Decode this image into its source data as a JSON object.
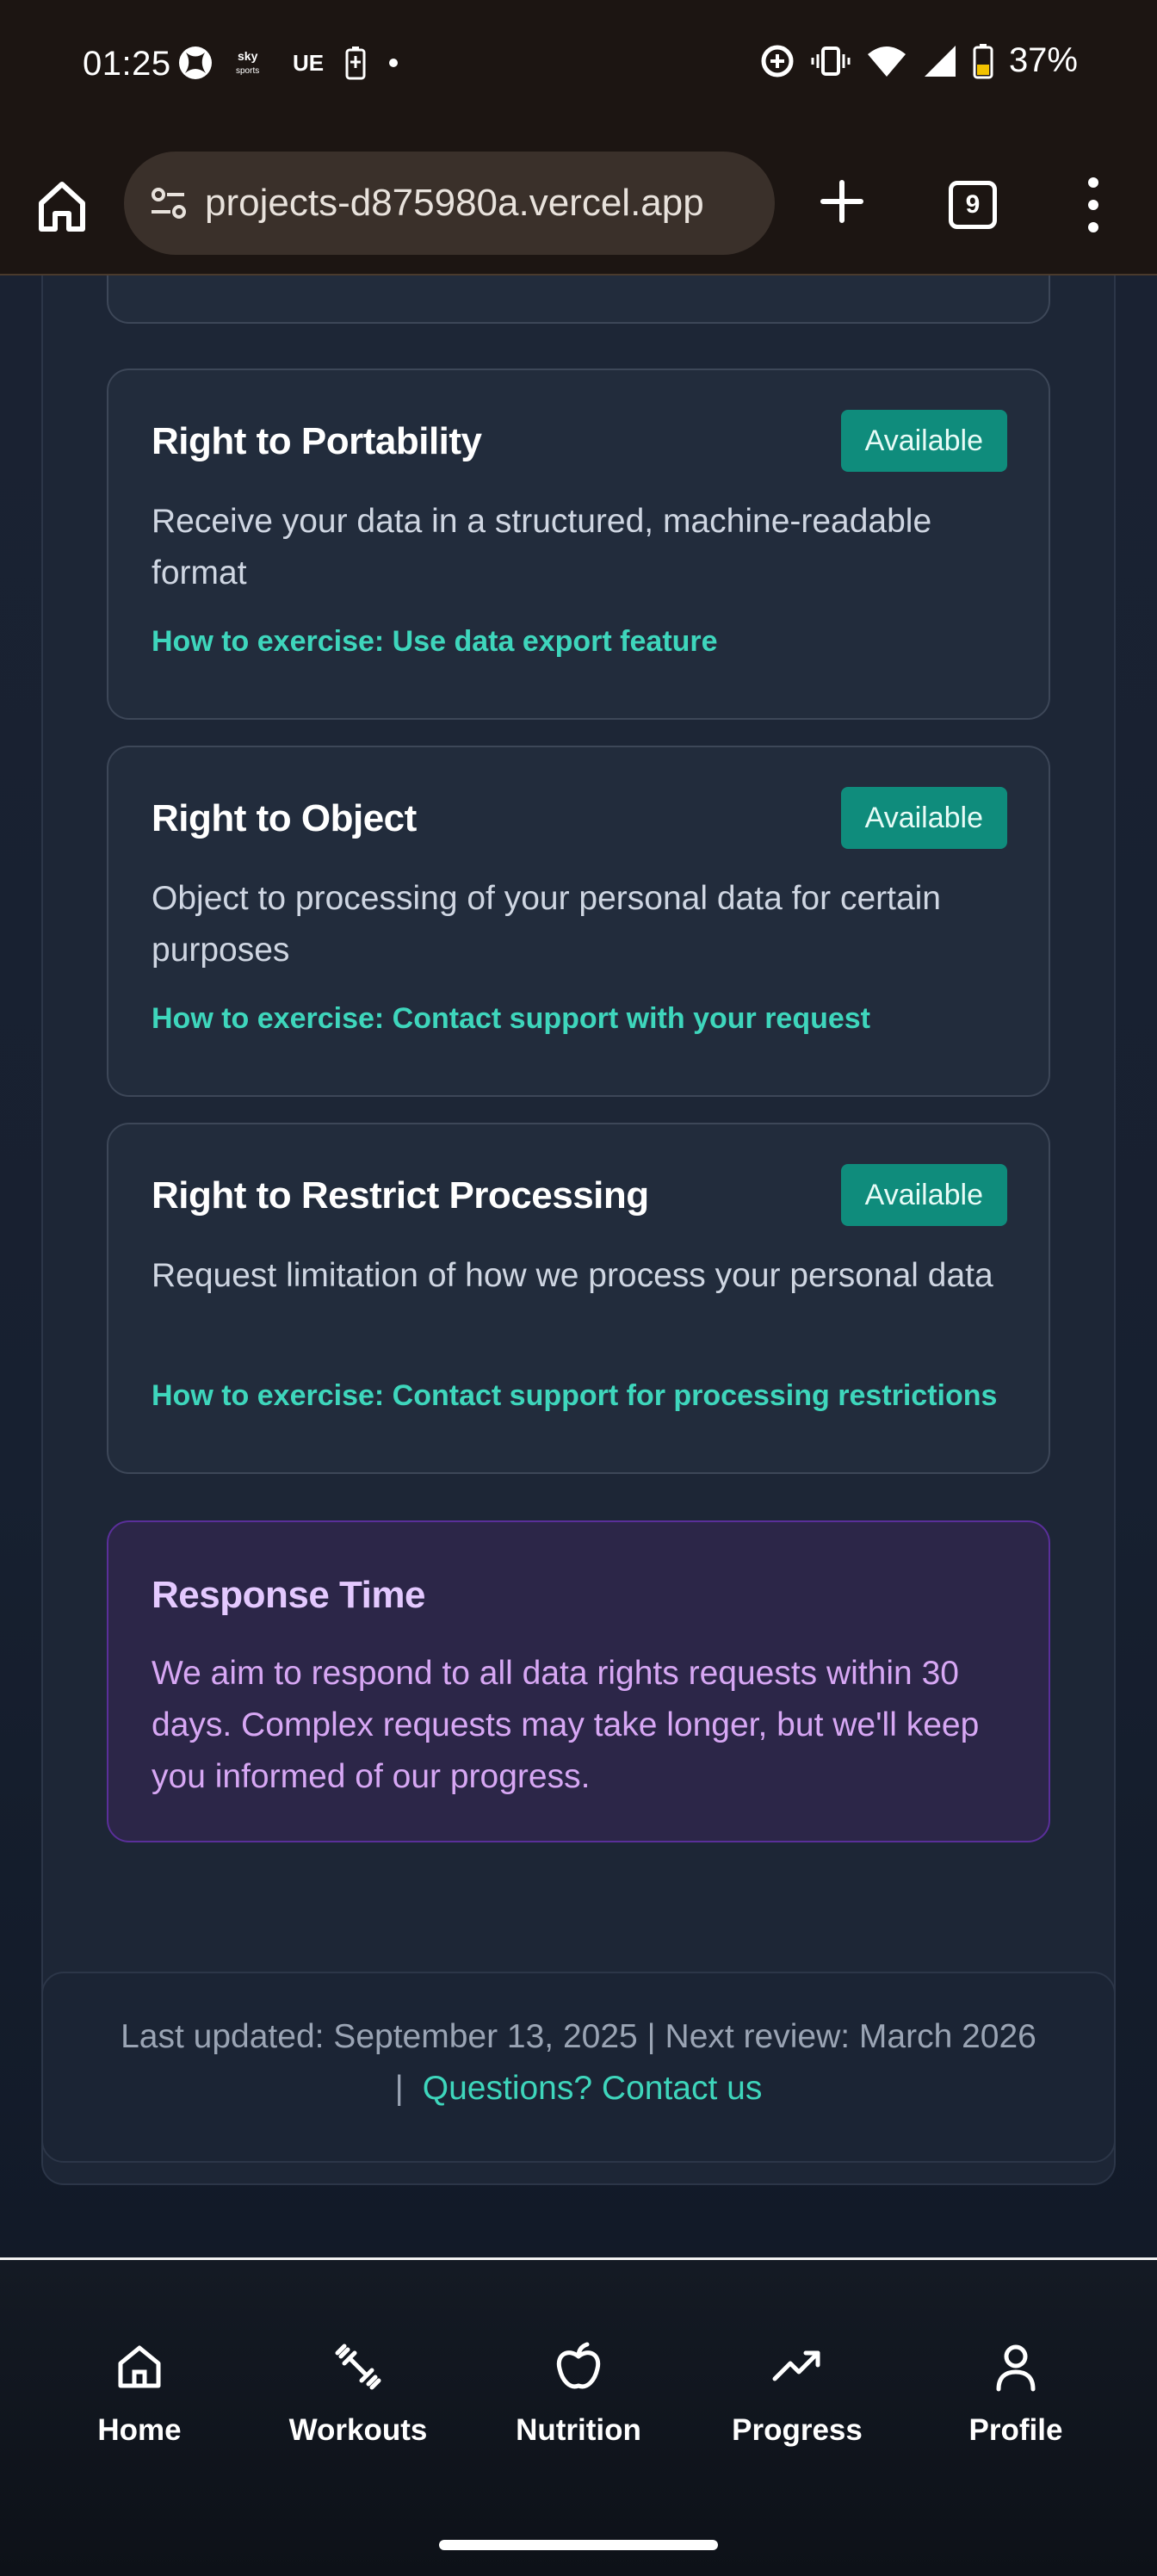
{
  "status_bar": {
    "time": "01:25",
    "left_icons": [
      "xbox-icon",
      "sky-sports-icon",
      "ue-icon",
      "battery-saver-icon",
      "dot-icon"
    ],
    "sky_label": "sky sports",
    "ue_label": "UE",
    "right_icons": [
      "data-saver-icon",
      "vibrate-icon",
      "wifi-icon",
      "signal-icon",
      "battery-icon"
    ],
    "battery": "37%"
  },
  "browser": {
    "url": "projects-d875980a.vercel.app",
    "tab_count": "9"
  },
  "rights": [
    {
      "title": "Right to Portability",
      "badge": "Available",
      "description": "Receive your data in a structured, machine-readable format",
      "how": "How to exercise: Use data export feature"
    },
    {
      "title": "Right to Object",
      "badge": "Available",
      "description": "Object to processing of your personal data for certain purposes",
      "how": "How to exercise: Contact support with your request"
    },
    {
      "title": "Right to Restrict Processing",
      "badge": "Available",
      "description": "Request limitation of how we process your personal data",
      "how": "How to exercise: Contact support for processing restrictions"
    }
  ],
  "response": {
    "title": "Response Time",
    "text": "We aim to respond to all data rights requests within 30 days. Complex requests may take longer, but we'll keep you informed of our progress."
  },
  "footer": {
    "updated": "Last updated: September 13, 2025 | Next review: March 2026",
    "separator": "|",
    "contact_link": "Questions? Contact us"
  },
  "nav": {
    "items": [
      {
        "label": "Home",
        "icon": "home-icon"
      },
      {
        "label": "Workouts",
        "icon": "dumbbell-icon"
      },
      {
        "label": "Nutrition",
        "icon": "apple-icon"
      },
      {
        "label": "Progress",
        "icon": "trending-up-icon"
      },
      {
        "label": "Profile",
        "icon": "user-icon"
      }
    ]
  }
}
